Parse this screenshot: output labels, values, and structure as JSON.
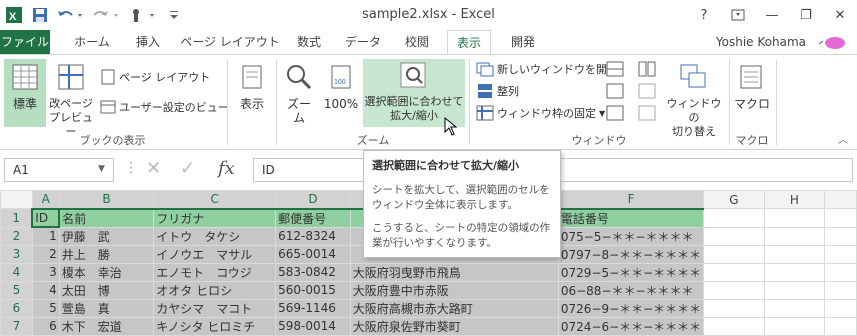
{
  "window": {
    "title": "sample2.xlsx - Excel",
    "help": "?",
    "minimize": "—",
    "restore": "❐",
    "close": "✕",
    "user": "Yoshie Kohama"
  },
  "tabs": [
    {
      "label": "ファイル"
    },
    {
      "label": "ホーム"
    },
    {
      "label": "挿入"
    },
    {
      "label": "ページ レイアウト"
    },
    {
      "label": "数式"
    },
    {
      "label": "データ"
    },
    {
      "label": "校閲"
    },
    {
      "label": "表示"
    },
    {
      "label": "開発"
    }
  ],
  "ribbon": {
    "book_views": {
      "label": "ブックの表示",
      "normal": "標準",
      "page_break": "改ページ\nプレビュー",
      "page_layout": "ページ レイアウト",
      "custom_views": "ユーザー設定のビュー"
    },
    "show": {
      "label": "表示"
    },
    "zoom": {
      "label": "ズーム",
      "zoom": "ズーム",
      "hundred": "100%",
      "zoom_selection": "選択範囲に合わせて\n拡大/縮小"
    },
    "window": {
      "label": "ウィンドウ",
      "new_window": "新しいウィンドウを開く",
      "arrange": "整列",
      "freeze": "ウィンドウ枠の固定",
      "switch": "ウィンドウの\n切り替え"
    },
    "macro": {
      "label": "マクロ",
      "macro": "マクロ"
    }
  },
  "formula_bar": {
    "name_box": "A1",
    "fx": "fx",
    "value": "ID"
  },
  "tooltip": {
    "title": "選択範囲に合わせて拡大/縮小",
    "body1": "シートを拡大して、選択範囲のセルを\nウィンドウ全体に表示します。",
    "body2": "こうすると、シートの特定の領域の作\n業が行いやすくなります。"
  },
  "sheet": {
    "columns": [
      "A",
      "B",
      "C",
      "D",
      "E",
      "F",
      "G",
      "H"
    ],
    "rows": [
      {
        "n": "1",
        "a": "ID",
        "b": "名前",
        "c": "フリガナ",
        "d": "郵便番号",
        "e": "",
        "f": "電話番号"
      },
      {
        "n": "2",
        "a": "1",
        "b": "伊藤　武",
        "c": "イトウ　タケシ",
        "d": "612-8324",
        "e": "",
        "f": "075−5−＊＊−＊＊＊＊"
      },
      {
        "n": "3",
        "a": "2",
        "b": "井上　勝",
        "c": "イノウエ　マサル",
        "d": "665-0014",
        "e": "",
        "f": "0797−8−＊＊−＊＊＊＊"
      },
      {
        "n": "4",
        "a": "3",
        "b": "榎本　幸治",
        "c": "エノモト　コウジ",
        "d": "583-0842",
        "e": "大阪府羽曳野市飛鳥",
        "f": "0729−5−＊＊−＊＊＊＊"
      },
      {
        "n": "5",
        "a": "4",
        "b": "太田　博",
        "c": "オオタ ヒロシ",
        "d": "560-0015",
        "e": "大阪府豊中市赤阪",
        "f": "06−88−＊＊−＊＊＊＊"
      },
      {
        "n": "6",
        "a": "5",
        "b": "萱島　真",
        "c": "カヤシマ　マコト",
        "d": "569-1146",
        "e": "大阪府高槻市赤大路町",
        "f": "0726−9−＊＊−＊＊＊＊"
      },
      {
        "n": "7",
        "a": "6",
        "b": "木下　宏道",
        "c": "キノシタ ヒロミチ",
        "d": "598-0014",
        "e": "大阪府泉佐野市葵町",
        "f": "0724−6−＊＊−＊＊＊＊"
      }
    ]
  },
  "colors": {
    "accent": "#217346",
    "selection": "#c6c6c6",
    "header_sel": "#8fcfa0"
  }
}
